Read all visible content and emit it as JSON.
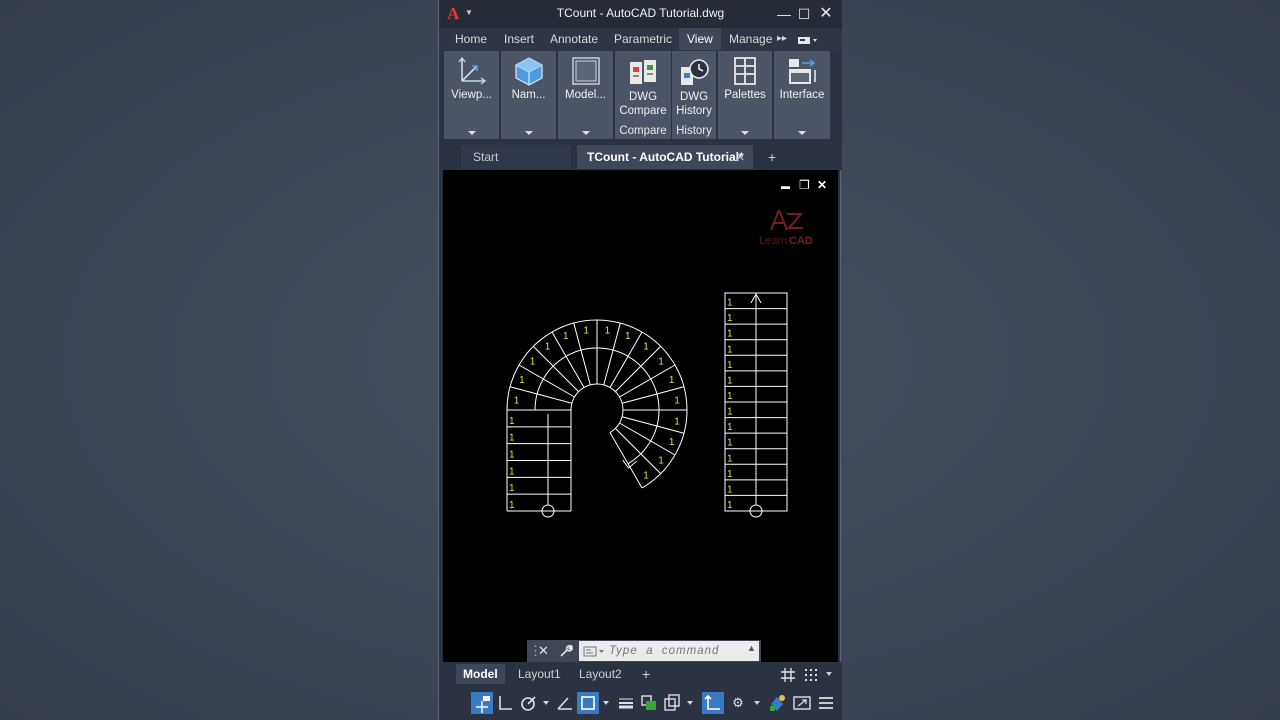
{
  "window": {
    "title": "TCount - AutoCAD Tutorial.dwg",
    "minimize": "—",
    "maximize": "☐",
    "close": "✕"
  },
  "ribbon_tabs": [
    "Home",
    "Insert",
    "Annotate",
    "Parametric",
    "View",
    "Manage"
  ],
  "ribbon_overflow": "▸▸",
  "panels": {
    "viewports": "Viewp...",
    "named_views": "Nam...",
    "model_viewports": "Model...",
    "dwg_compare_line1": "DWG",
    "dwg_compare_line2": "Compare",
    "dwg_compare_footer": "Compare",
    "dwg_history_line1": "DWG",
    "dwg_history_line2": "History",
    "dwg_history_footer": "History",
    "palettes": "Palettes",
    "interface": "Interface"
  },
  "doc_tabs": {
    "start": "Start",
    "active": "TCount - AutoCAD Tutorial*",
    "close": "✕",
    "add": "+"
  },
  "viewport_controls": {
    "minimize": "▬",
    "restore": "❐",
    "close": "✕"
  },
  "watermark": {
    "prefix": "Learn",
    "suffix": "CAD"
  },
  "drawing": {
    "tread_label": "1",
    "spiral_tread_count": 22,
    "straight_tread_count": 14
  },
  "command": {
    "placeholder": "Type  a  command"
  },
  "layout_tabs": [
    "Model",
    "Layout1",
    "Layout2"
  ],
  "layout_add": "+"
}
